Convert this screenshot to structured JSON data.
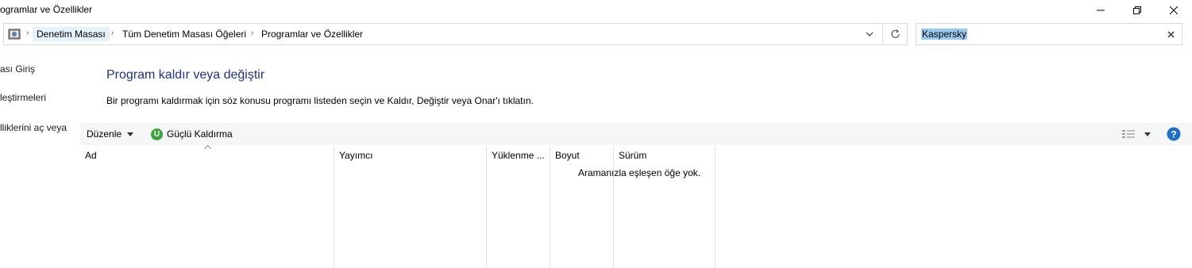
{
  "window": {
    "title": "ogramlar ve Özellikler"
  },
  "breadcrumb": {
    "items": [
      "Denetim Masası",
      "Tüm Denetim Masası Öğeleri",
      "Programlar ve Özellikler"
    ]
  },
  "search": {
    "value": "Kaspersky"
  },
  "sidebar": {
    "items": [
      {
        "label": "ası Giriş"
      },
      {
        "label": "leştirmeleri"
      },
      {
        "label": "lliklerini aç veya"
      }
    ]
  },
  "main": {
    "heading": "Program kaldır veya değiştir",
    "description": "Bir programı kaldırmak için söz konusu programı listeden seçin ve Kaldır, Değiştir veya Onar'ı tıklatın."
  },
  "toolbar": {
    "organize_label": "Düzenle",
    "uninstaller_label": "Güçlü Kaldırma",
    "uninstaller_icon_letter": "U"
  },
  "table": {
    "columns": [
      "Ad",
      "Yayımcı",
      "Yüklenme ...",
      "Boyut",
      "Sürüm"
    ],
    "empty_message": "Aramanızla eşleşen öğe yok."
  },
  "colors": {
    "heading": "#1e3287",
    "selection": "#99c9ef",
    "accent_green": "#3aa53a",
    "help_blue": "#1f6fc5"
  }
}
